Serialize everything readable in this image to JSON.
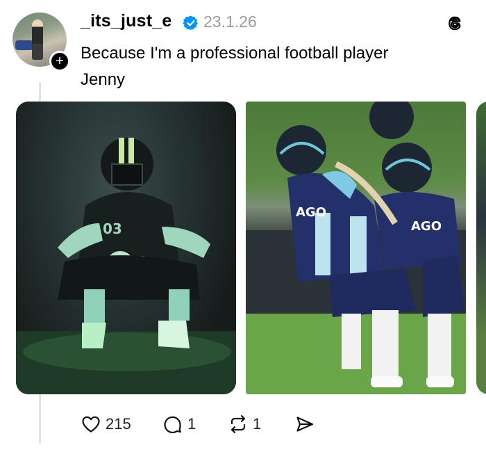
{
  "post": {
    "username": "_its_just_e",
    "date": "23.1.26",
    "caption_lines": [
      "Because I'm a professional football player",
      "Jenny"
    ],
    "follow_symbol": "+",
    "verified": true
  },
  "images": [
    {
      "name": "photo-crouching-player",
      "subject": "football player crouching in tunnel, jersey 03"
    },
    {
      "name": "photo-players-on-field",
      "subject": "two football players in blue Chicago uniforms lined up"
    },
    {
      "name": "photo-third-partial",
      "subject": "partially visible third photo"
    }
  ],
  "actions": {
    "likes": "215",
    "replies": "1",
    "reposts": "1"
  },
  "colors": {
    "verified_blue": "#0095f6",
    "muted_text": "#9a9a9a",
    "thread_line": "#e3e3e3"
  },
  "icons": [
    "threads-logo-icon",
    "verified-badge-icon",
    "heart-icon",
    "comment-icon",
    "repost-icon",
    "share-icon"
  ]
}
